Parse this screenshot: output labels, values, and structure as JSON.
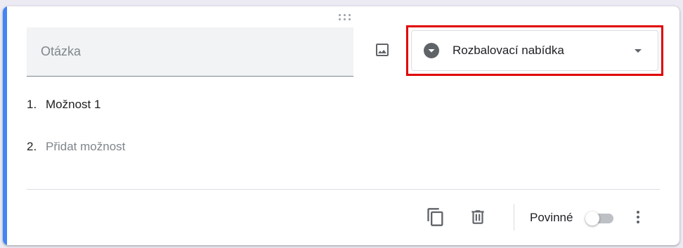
{
  "question": {
    "placeholder": "Otázka",
    "value": ""
  },
  "question_type": {
    "selected": "Rozbalovací nabídka",
    "icon": "dropdown-circle-icon"
  },
  "options": [
    {
      "number": "1.",
      "label": "Možnost 1"
    }
  ],
  "add_option": {
    "number": "2.",
    "label": "Přidat možnost"
  },
  "footer": {
    "required_label": "Povinné",
    "required_on": false
  },
  "icons": {
    "drag": "drag-handle-icon",
    "image": "image-icon",
    "duplicate": "copy-icon",
    "delete": "trash-icon",
    "more": "more-vert-icon"
  },
  "colors": {
    "accent": "#4285f4",
    "highlight": "#e00000",
    "icon": "#5f6368"
  }
}
